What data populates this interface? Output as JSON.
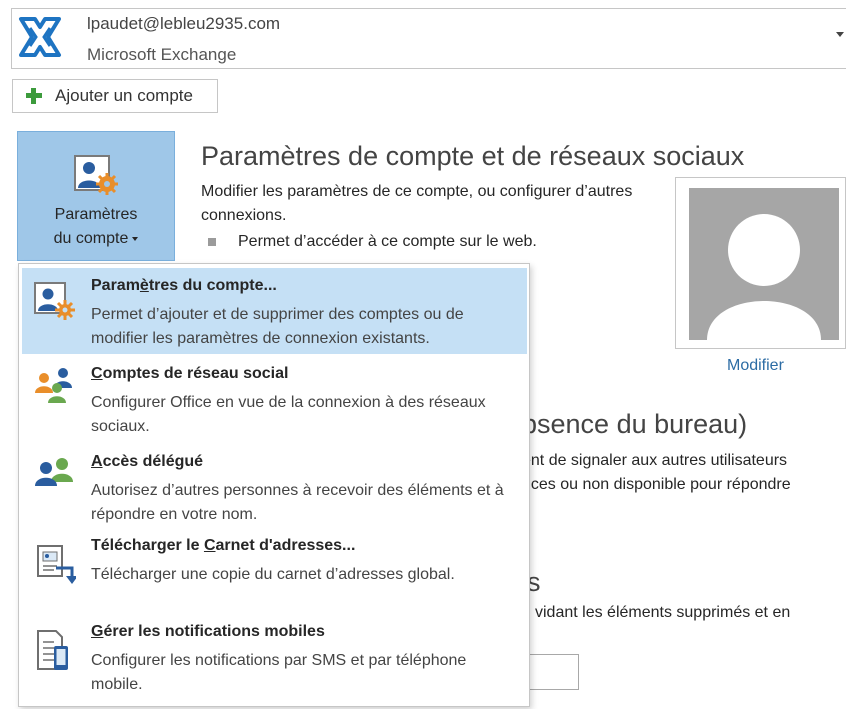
{
  "account": {
    "email": "lpaudet@lebleu2935.com",
    "type": "Microsoft Exchange"
  },
  "add_account": {
    "label": "Ajouter un compte",
    "icon": "plus-icon",
    "icon_color": "#3c9b3c"
  },
  "settings_button": {
    "label_line1": "Paramètres",
    "label_line2": "du compte",
    "icon": "account-settings-icon",
    "bg_color": "#9fc7e8"
  },
  "section": {
    "title": "Paramètres de compte et de réseaux sociaux",
    "description": "Modifier les paramètres de ce compte, ou configurer d’autres connexions.",
    "bullet": "Permet d’accéder à ce compte sur le web."
  },
  "profile": {
    "modify_label": "Modifier"
  },
  "background": {
    "oof_title": "bsence du bureau)",
    "oof_line1": "ent de signaler aux autres utilisateurs",
    "oof_line2": "nces ou non disponible pour répondre",
    "cleanup_title": "s",
    "cleanup_line1": "vidant les éléments supprimés et en",
    "cleanup_line2": ""
  },
  "menu": {
    "items": [
      {
        "title_pre": "Param",
        "title_accel": "è",
        "title_post": "tres du compte...",
        "description": "Permet d’ajouter et de supprimer des comptes ou de modifier les paramètres de connexion existants.",
        "icon": "account-settings-icon",
        "highlighted": true
      },
      {
        "title_pre": "",
        "title_accel": "C",
        "title_post": "omptes de réseau social",
        "description": "Configurer Office en vue de la connexion à des réseaux sociaux.",
        "icon": "social-accounts-icon",
        "highlighted": false
      },
      {
        "title_pre": "",
        "title_accel": "A",
        "title_post": "ccès délégué",
        "description": "Autorisez d’autres personnes à recevoir des éléments et à répondre en votre nom.",
        "icon": "delegate-access-icon",
        "highlighted": false
      },
      {
        "title_pre": "Télécharger le ",
        "title_accel": "C",
        "title_post": "arnet d'adresses...",
        "description": "Télécharger une copie du carnet d’adresses global.",
        "icon": "download-address-book-icon",
        "highlighted": false
      },
      {
        "title_pre": "",
        "title_accel": "G",
        "title_post": "érer les notifications mobiles",
        "description": "Configurer les notifications par SMS et par téléphone mobile.",
        "icon": "mobile-notifications-icon",
        "highlighted": false
      }
    ]
  }
}
